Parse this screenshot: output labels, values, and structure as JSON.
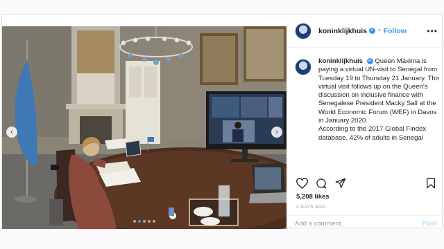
{
  "post": {
    "username": "koninklijkhuis",
    "verified_badge": "✔",
    "separator": "•",
    "follow_label": "Follow",
    "more_icon": "more-horizontal-icon",
    "caption_username": "koninklijkhuis",
    "caption_text": "Queen Máxima is paying a virtual UN-visit to Senegal from Tuesday 19 to Thursday 21 January. This virtual visit follows up on the Queen's discussion on inclusive finance with Senegalese President Macky Sall at the World Economic Forum (WEF) in Davos in January 2020.",
    "caption_text_2": "According to the 2017 Global Findex database, 42% of adults in Senegal",
    "likes": "5,208 likes",
    "date": "2 DAYS AGO",
    "comment_placeholder": "Add a comment...",
    "post_label": "Post",
    "carousel": {
      "prev_icon": "‹",
      "next_icon": "›",
      "slide_count": 5,
      "active_index": 1
    }
  },
  "colors": {
    "accent": "#3897f0",
    "text": "#262626",
    "muted": "#999999",
    "post_disabled": "#b2dffc"
  }
}
